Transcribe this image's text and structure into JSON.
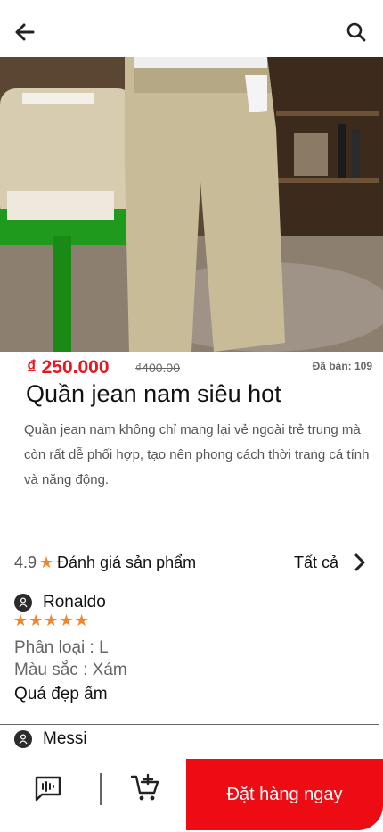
{
  "product": {
    "price": "₫ 250.000",
    "old_price": "₫400.00",
    "sold": "Đã bán: 109",
    "title": "Quần jean nam siêu hot",
    "description": "Quần jean nam không chỉ mang lại vẻ ngoài trẻ trung mà còn rất dễ phối hợp, tạo nên phong cách thời trang cá tính và năng động."
  },
  "ratings": {
    "score": "4.9",
    "star": "★",
    "title": "Đánh giá sản phẩm",
    "see_all": "Tất cả"
  },
  "reviews": [
    {
      "name": "Ronaldo",
      "stars": "★★★★★",
      "variant": "Phân loại : L",
      "color": "Màu sắc : Xám",
      "comment": "Quá đẹp ấm"
    },
    {
      "name": "Messi"
    }
  ],
  "actions": {
    "order_label": "Đặt hàng ngay"
  },
  "colors": {
    "accent": "#ee0c14",
    "price": "#e8171f",
    "star": "#f0862c"
  },
  "icons": [
    "back-arrow-icon",
    "search-icon",
    "chevron-right-icon",
    "user-icon",
    "chat-icon",
    "add-to-cart-icon"
  ]
}
